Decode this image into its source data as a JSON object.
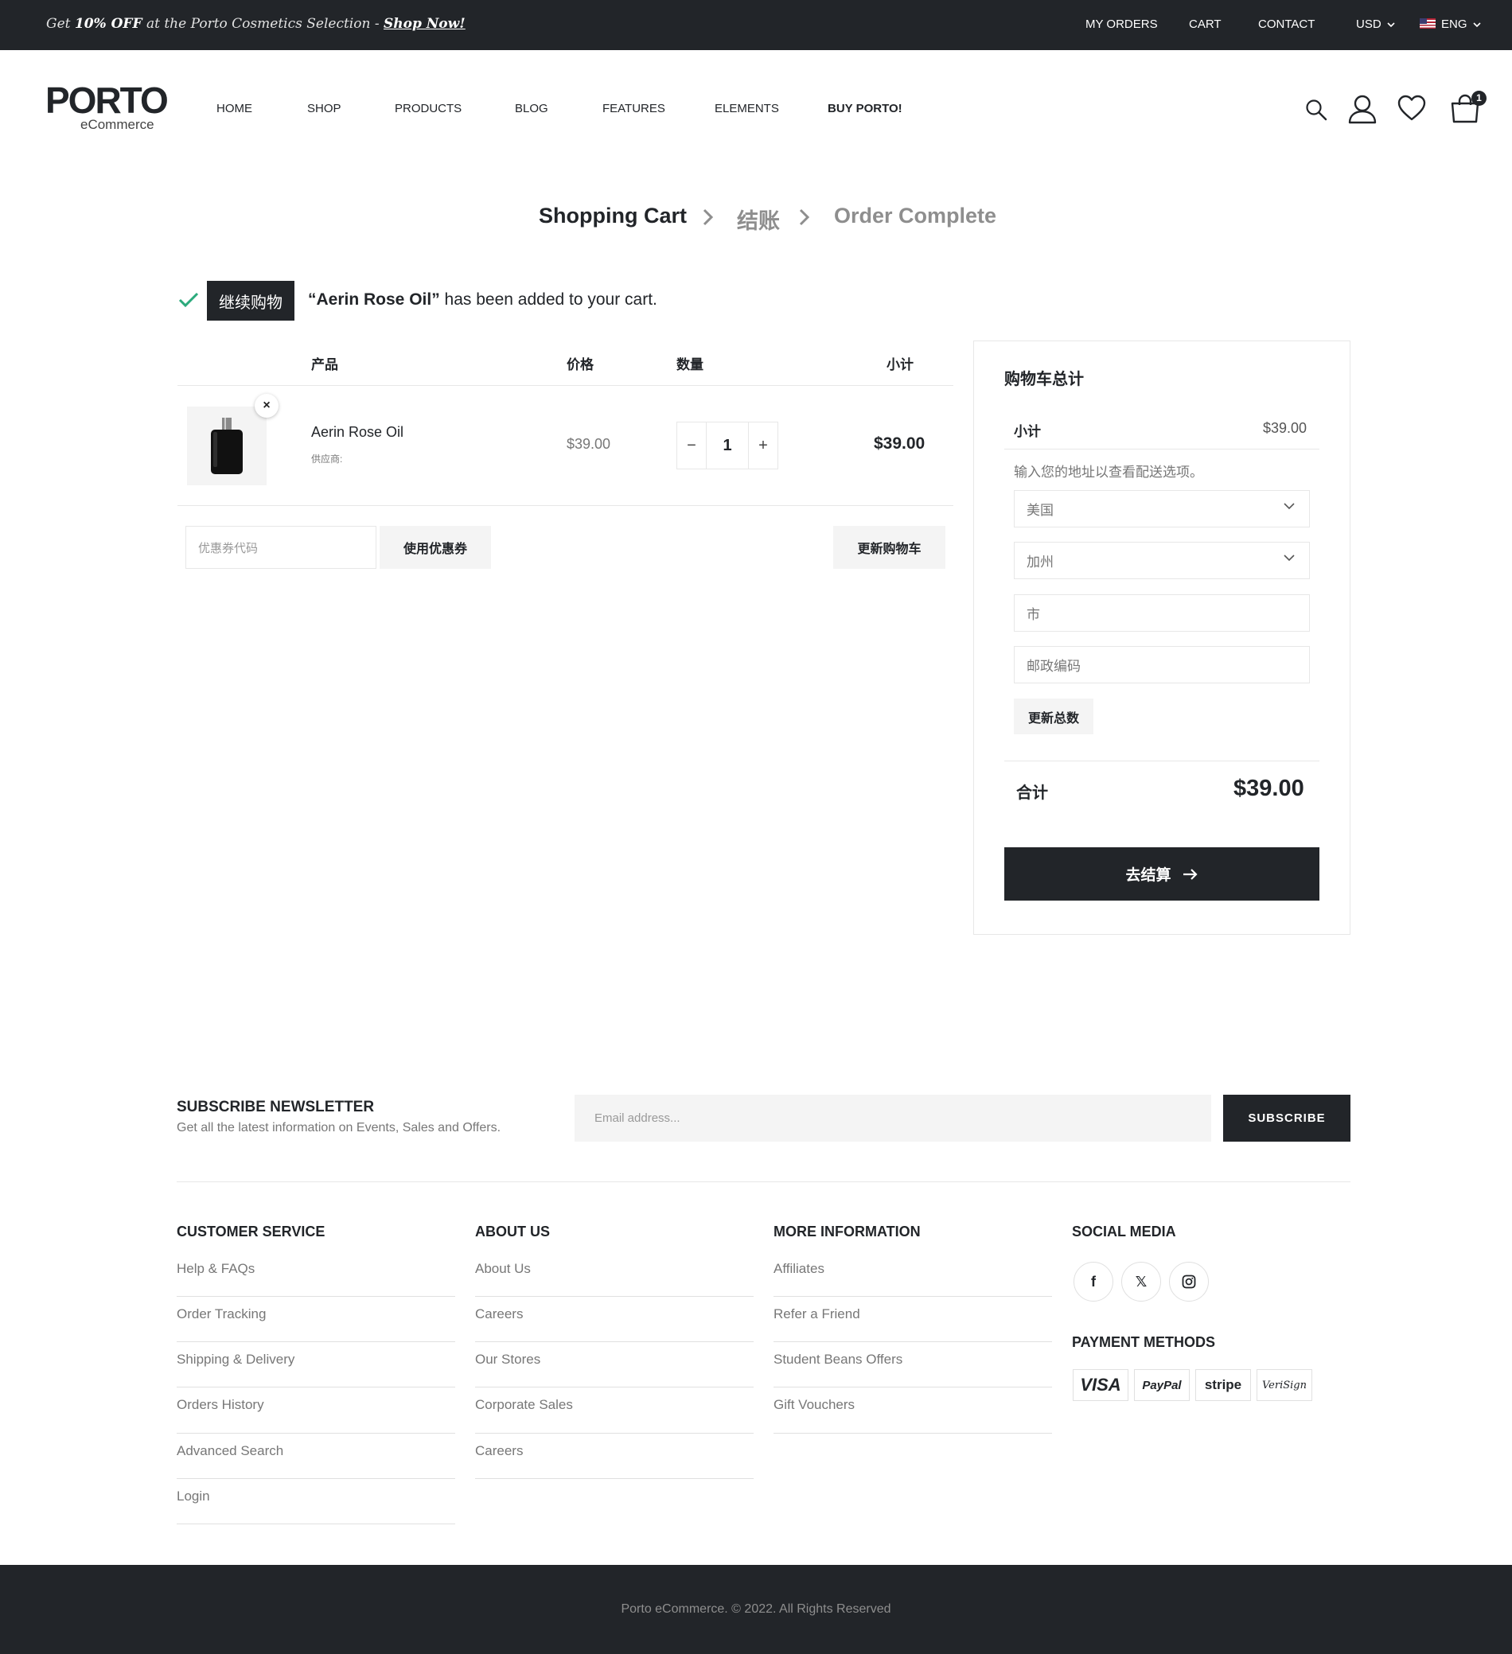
{
  "topbar": {
    "promo_pre": "Get ",
    "promo_bold": "10% OFF",
    "promo_mid": " at the Porto Cosmetics Selection - ",
    "promo_link": "Shop Now!",
    "links": [
      "MY ORDERS",
      "CART",
      "CONTACT"
    ],
    "currency": "USD",
    "language": "ENG"
  },
  "header": {
    "logo_main": "PORTO",
    "logo_sub": "eCommerce",
    "nav": [
      "HOME",
      "SHOP",
      "PRODUCTS",
      "BLOG",
      "FEATURES",
      "ELEMENTS",
      "BUY PORTO!"
    ],
    "cart_count": "1",
    "icons": [
      "search-icon",
      "user-icon",
      "heart-icon",
      "cart-icon"
    ]
  },
  "steps": {
    "step1": "Shopping Cart",
    "step2": "结账",
    "step3": "Order Complete"
  },
  "notice": {
    "continue_button": "继续购物",
    "product_quoted": "“Aerin Rose Oil”",
    "message_rest": " has been added to your cart."
  },
  "cart_table": {
    "headers": {
      "product": "产品",
      "price": "价格",
      "quantity": "数量",
      "subtotal": "小计"
    },
    "rows": [
      {
        "name": "Aerin Rose Oil",
        "vendor": "供应商:",
        "price": "$39.00",
        "quantity": "1",
        "subtotal": "$39.00"
      }
    ],
    "coupon_placeholder": "优惠券代码",
    "apply_coupon": "使用优惠券",
    "update_cart": "更新购物车"
  },
  "totals": {
    "title": "购物车总计",
    "subtotal_label": "小计",
    "subtotal_value": "$39.00",
    "shipping_note": "输入您的地址以查看配送选项。",
    "country": "美国",
    "state": "加州",
    "city_placeholder": "市",
    "zip_placeholder": "邮政编码",
    "update_totals": "更新总数",
    "total_label": "合计",
    "total_value": "$39.00",
    "checkout": "去结算"
  },
  "newsletter": {
    "title": "SUBSCRIBE NEWSLETTER",
    "subtitle": "Get all the latest information on Events, Sales and Offers.",
    "email_placeholder": "Email address...",
    "subscribe": "SUBSCRIBE"
  },
  "footer": {
    "customer_service": {
      "title": "CUSTOMER SERVICE",
      "links": [
        "Help & FAQs",
        "Order Tracking",
        "Shipping & Delivery",
        "Orders History",
        "Advanced Search",
        "Login"
      ]
    },
    "about_us": {
      "title": "ABOUT US",
      "links": [
        "About Us",
        "Careers",
        "Our Stores",
        "Corporate Sales",
        "Careers"
      ]
    },
    "more_info": {
      "title": "MORE INFORMATION",
      "links": [
        "Affiliates",
        "Refer a Friend",
        "Student Beans Offers",
        "Gift Vouchers"
      ]
    },
    "social": {
      "title": "SOCIAL MEDIA",
      "icons": [
        "facebook-icon",
        "x-icon",
        "instagram-icon"
      ]
    },
    "payment": {
      "title": "PAYMENT METHODS",
      "methods": [
        "VISA",
        "PayPal",
        "stripe",
        "VeriSign"
      ]
    },
    "copyright": "Porto eCommerce. © 2022. All Rights Reserved"
  }
}
